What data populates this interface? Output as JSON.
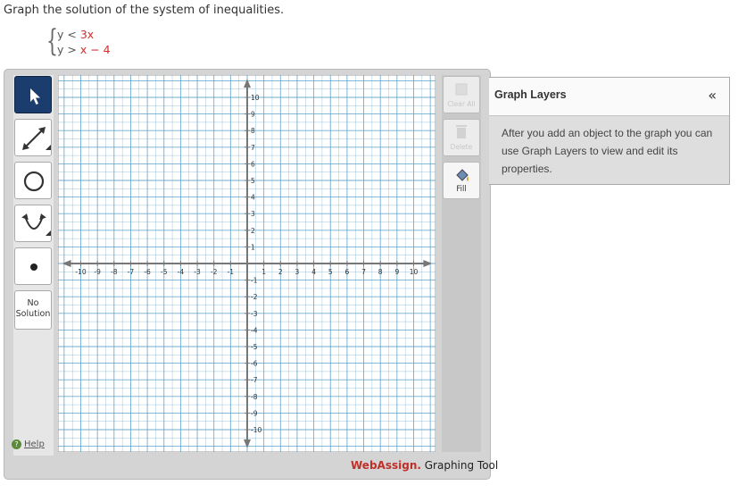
{
  "prompt": "Graph the solution of the system of inequalities.",
  "system": {
    "ineq1": {
      "lhs": "y",
      "rel": "<",
      "rhs": "3x"
    },
    "ineq2": {
      "lhs": "y",
      "rel": ">",
      "rhs": "x − 4"
    }
  },
  "tools": {
    "pointer": "pointer-icon",
    "line": "line-icon",
    "circle": "circle-icon",
    "parabola": "parabola-icon",
    "point": "point-icon",
    "no_solution_line1": "No",
    "no_solution_line2": "Solution",
    "help": "Help"
  },
  "actions": {
    "clear_all": "Clear All",
    "delete": "Delete",
    "fill": "Fill"
  },
  "graph": {
    "xmin": -10,
    "xmax": 10,
    "ymin": -10,
    "ymax": 10,
    "x_ticks": [
      "-10",
      "-9",
      "-8",
      "-7",
      "-6",
      "-5",
      "-4",
      "-3",
      "-2",
      "-1",
      "1",
      "2",
      "3",
      "4",
      "5",
      "6",
      "7",
      "8",
      "9",
      "10"
    ],
    "y_ticks": [
      "10",
      "9",
      "8",
      "7",
      "6",
      "5",
      "4",
      "3",
      "2",
      "1",
      "-1",
      "-2",
      "-3",
      "-4",
      "-5",
      "-6",
      "-7",
      "-8",
      "-9",
      "-10"
    ],
    "grid_color": "#5aa0c8",
    "axis_color": "#777777"
  },
  "brand": {
    "web": "WebAssign.",
    "tool": " Graphing Tool"
  },
  "layers": {
    "title": "Graph Layers",
    "collapse": "«",
    "body": "After you add an object to the graph you can use Graph Layers to view and edit its properties."
  }
}
